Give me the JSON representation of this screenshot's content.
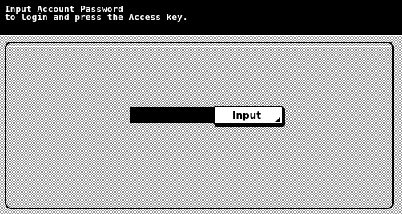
{
  "header": {
    "line1": "Input Account Password",
    "line2": "to login and press the Access key."
  },
  "login": {
    "password_value": "",
    "input_button_label": "Input"
  },
  "colors": {
    "header_bg": "#000000",
    "header_text": "#ffffff",
    "field_bg": "#000000",
    "button_bg": "#ffffff"
  },
  "icons": {
    "button_corner": "corner-triangle-icon"
  }
}
